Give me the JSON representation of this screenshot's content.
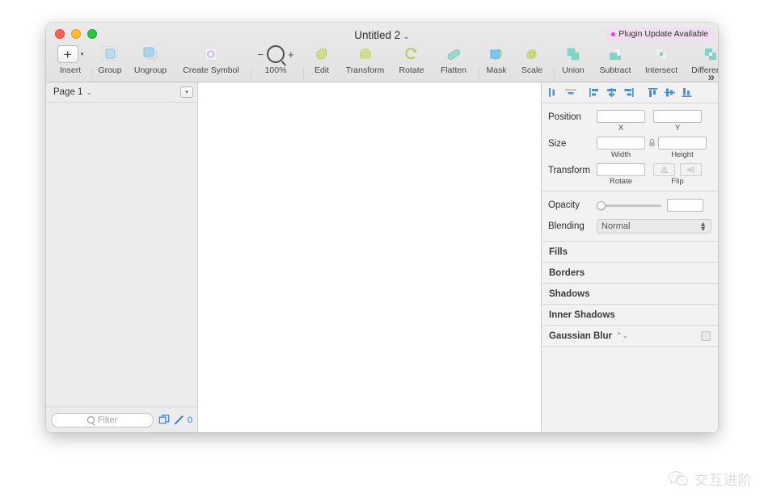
{
  "window": {
    "title": "Untitled 2",
    "title_chevron": "⌄",
    "traffic_lights": [
      "close",
      "minimize",
      "zoom"
    ]
  },
  "plugin_badge": {
    "label": "Plugin Update Available",
    "dot_color": "#e345c9",
    "bg_color": "#f0dff0"
  },
  "toolbar": {
    "items": [
      {
        "label": "Insert",
        "icon": "plus-icon"
      },
      {
        "label": "Group",
        "icon": "group-icon"
      },
      {
        "label": "Ungroup",
        "icon": "ungroup-icon"
      },
      {
        "label": "Create Symbol",
        "icon": "create-symbol-icon"
      },
      {
        "label": "100%",
        "icon": "magnifier-icon"
      },
      {
        "label": "Edit",
        "icon": "edit-icon"
      },
      {
        "label": "Transform",
        "icon": "transform-icon"
      },
      {
        "label": "Rotate",
        "icon": "rotate-icon"
      },
      {
        "label": "Flatten",
        "icon": "flatten-icon"
      },
      {
        "label": "Mask",
        "icon": "mask-icon"
      },
      {
        "label": "Scale",
        "icon": "scale-icon"
      },
      {
        "label": "Union",
        "icon": "union-icon"
      },
      {
        "label": "Subtract",
        "icon": "subtract-icon"
      },
      {
        "label": "Intersect",
        "icon": "intersect-icon"
      },
      {
        "label": "Difference",
        "icon": "difference-icon"
      }
    ],
    "zoom_minus": "−",
    "zoom_plus": "+",
    "zoom_level": "100%",
    "overflow": "»",
    "insert_plus": "+",
    "insert_caret": "▾"
  },
  "sidebar": {
    "page_name": "Page 1",
    "page_chevron": "⌄",
    "page_menu_icon": "dropdown-box-icon",
    "layers": [],
    "filter_placeholder": "Filter",
    "duplicate_icon": "duplicate-icon",
    "pencil_icon": "pencil-icon",
    "count": "0"
  },
  "inspector": {
    "align_buttons": [
      "align-left-icon",
      "align-center-horizontal-icon",
      "distribute-left-icon",
      "distribute-center-icon",
      "distribute-right-icon",
      "align-top-icon",
      "align-middle-icon",
      "align-bottom-icon"
    ],
    "position": {
      "label": "Position",
      "x_value": "",
      "x_sub": "X",
      "y_value": "",
      "y_sub": "Y"
    },
    "size": {
      "label": "Size",
      "width_value": "",
      "width_sub": "Width",
      "height_value": "",
      "height_sub": "Height",
      "lock_icon": "lock-icon"
    },
    "transform": {
      "label": "Transform",
      "rotate_value": "",
      "rotate_sub": "Rotate",
      "flip_sub": "Flip",
      "flip_vertical_icon": "flip-vertical-icon",
      "flip_horizontal_icon": "flip-horizontal-icon"
    },
    "opacity": {
      "label": "Opacity",
      "value": "",
      "slider_position_pct": 0
    },
    "blending": {
      "label": "Blending",
      "selected": "Normal",
      "options": [
        "Normal"
      ],
      "stepper_icon": "stepper-icon"
    },
    "sections": [
      {
        "label": "Fills",
        "has_stepper": false,
        "has_checkbox": false
      },
      {
        "label": "Borders",
        "has_stepper": false,
        "has_checkbox": false
      },
      {
        "label": "Shadows",
        "has_stepper": false,
        "has_checkbox": false
      },
      {
        "label": "Inner Shadows",
        "has_stepper": false,
        "has_checkbox": false
      },
      {
        "label": "Gaussian Blur",
        "has_stepper": true,
        "has_checkbox": true
      }
    ],
    "accent_color": "#4a90e2"
  },
  "watermark": {
    "text": "交互进阶",
    "icon": "wechat-icon"
  }
}
